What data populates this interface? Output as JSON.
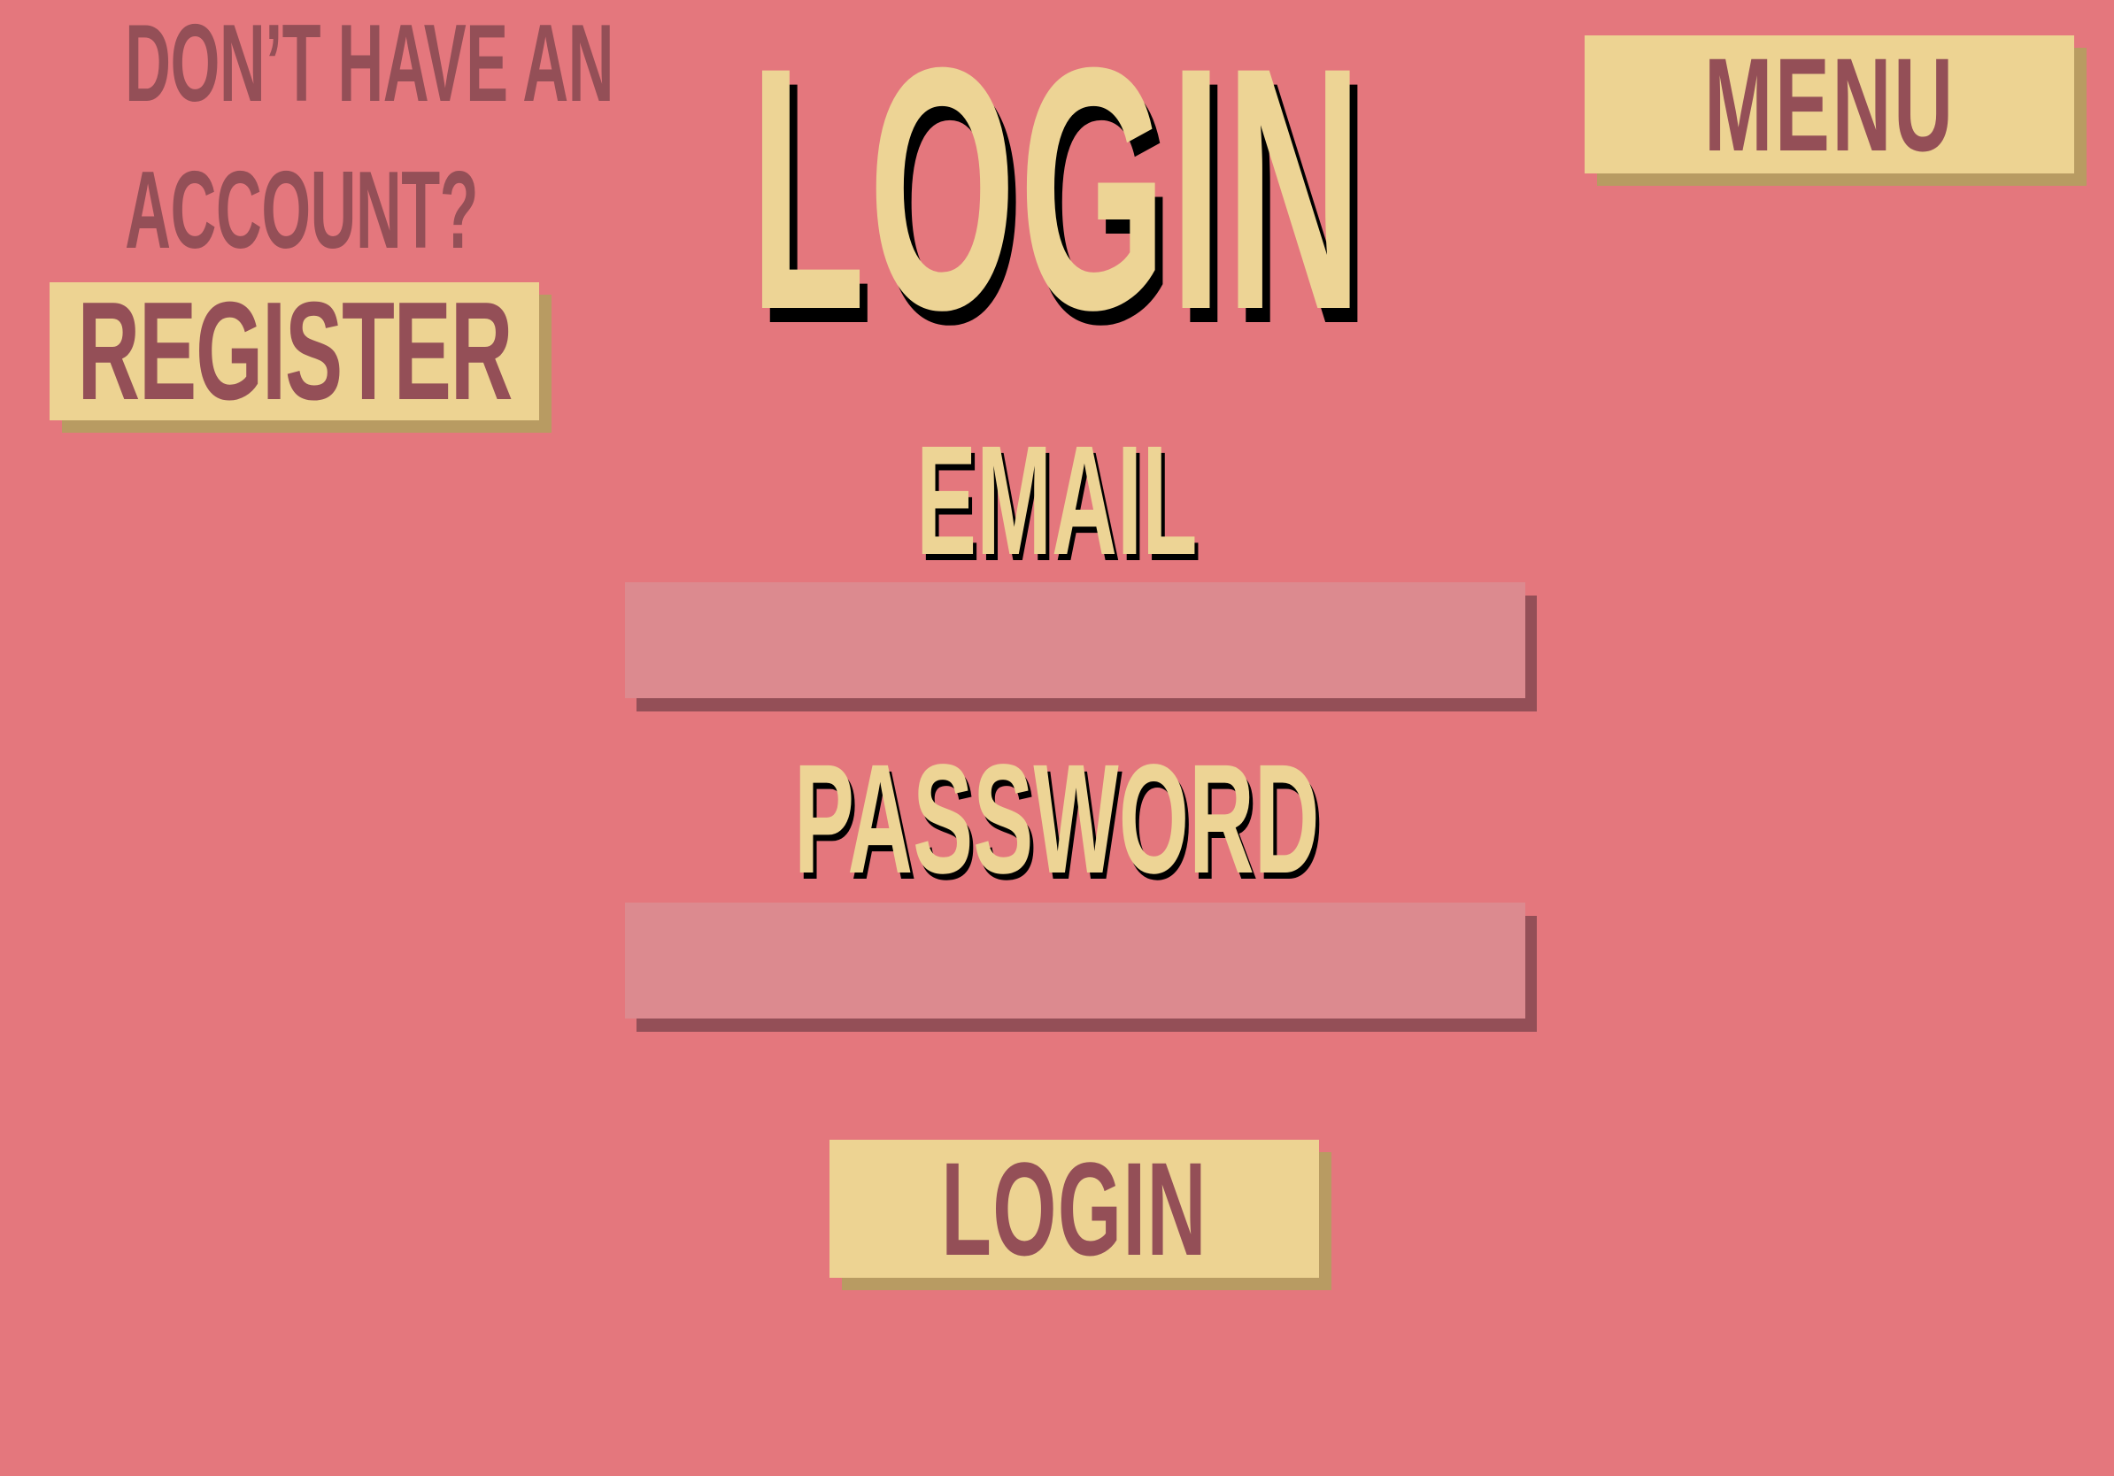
{
  "register_prompt": {
    "line1": "DON’T HAVE AN",
    "line2": "ACCOUNT?",
    "button_label": "REGISTER"
  },
  "menu": {
    "button_label": "MENU"
  },
  "title": "LOGIN",
  "form": {
    "email_label": "EMAIL",
    "email_value": "",
    "password_label": "PASSWORD",
    "password_value": "",
    "submit_label": "LOGIN"
  },
  "colors": {
    "background": "#e4777d",
    "button_fill": "#edd392",
    "button_text": "#944f57",
    "heading_text": "#edd495",
    "input_fill": "#dc8a8f",
    "input_shadow": "#944f57"
  }
}
